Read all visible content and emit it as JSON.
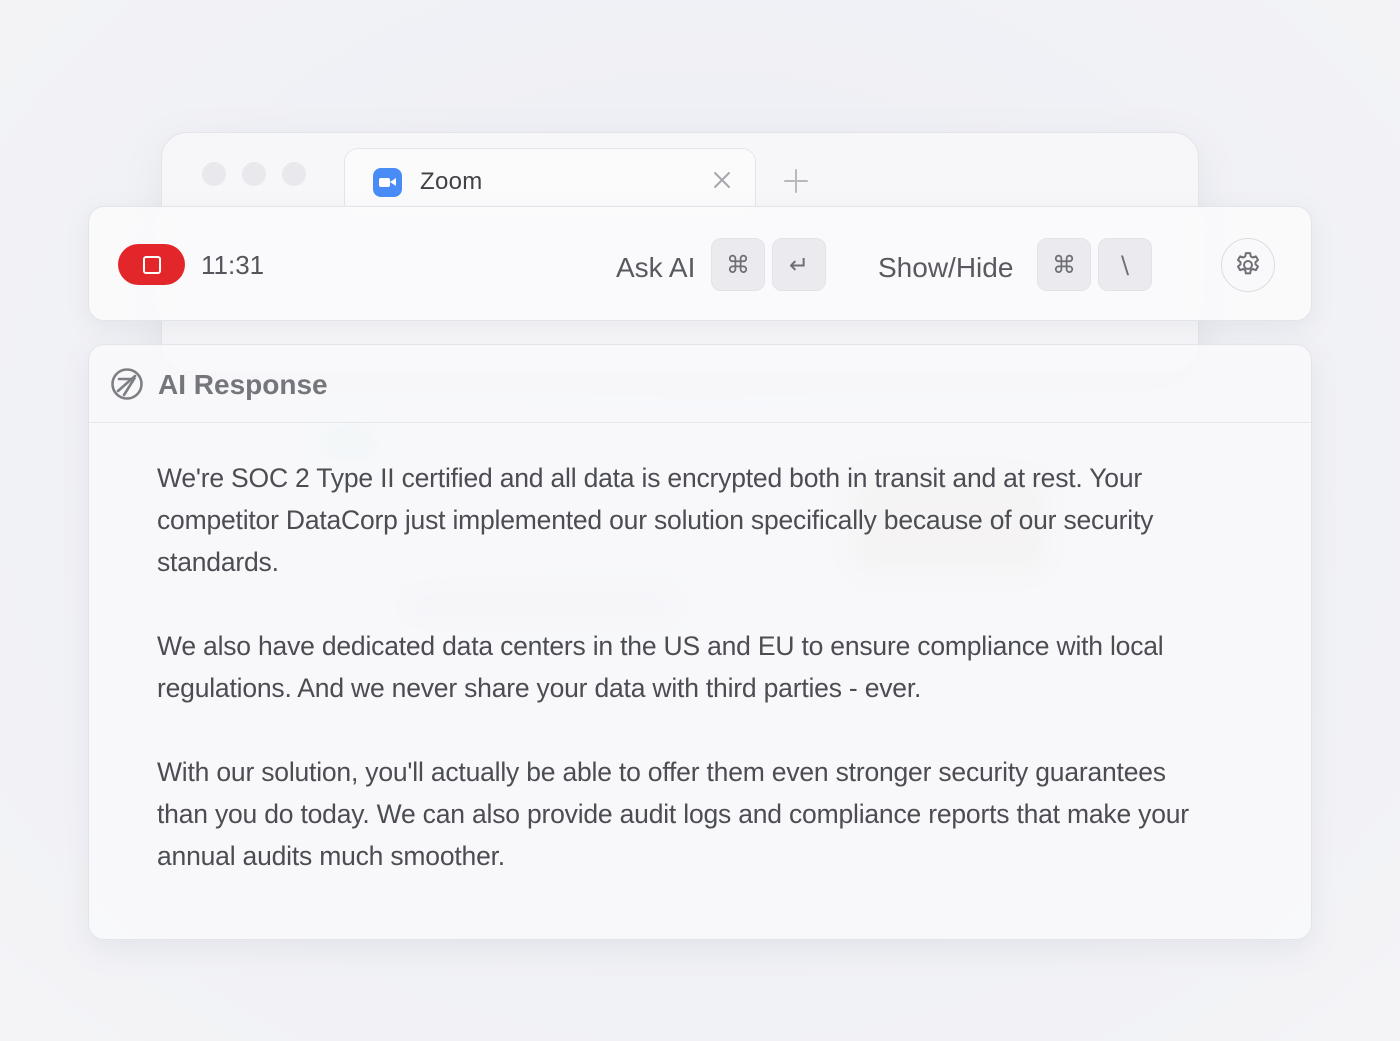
{
  "browser": {
    "tab_title": "Zoom",
    "tab_icon": "zoom-app-icon",
    "close_icon": "close-icon",
    "new_tab_icon": "plus-icon"
  },
  "toolbar": {
    "record_icon": "stop-square-icon",
    "record_color": "#e3262a",
    "timer": "11:31",
    "ask_ai_label": "Ask AI",
    "ask_ai_keys": [
      "⌘",
      "↵"
    ],
    "show_hide_label": "Show/Hide",
    "show_hide_keys": [
      "⌘",
      "\\"
    ],
    "settings_icon": "gear-icon"
  },
  "response": {
    "header_icon": "ai-aperture-icon",
    "title": "AI Response",
    "paragraphs": [
      "We're SOC 2 Type II certified and all data is encrypted both in transit and at rest. Your competitor DataCorp just implemented our solution specifically because of our security standards.",
      "We also have dedicated data centers in the US and EU to ensure compliance with local regulations. And we never share your data with third parties - ever.",
      "With our solution, you'll actually be able to offer them even stronger security guarantees than you do today. We can also provide audit logs and compliance reports that make your annual audits much smoother."
    ]
  }
}
